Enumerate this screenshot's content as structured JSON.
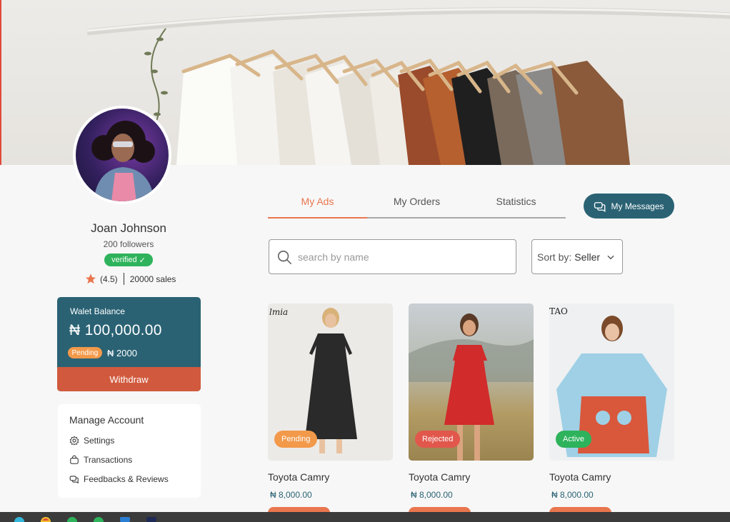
{
  "profile": {
    "name": "Joan Johnson",
    "followers": "200 followers",
    "verified": "verified",
    "rating": "(4.5)",
    "sales": "20000 sales"
  },
  "wallet": {
    "label": "Walet Balance",
    "amount": "₦ 100,000.00",
    "pending_label": "Pending",
    "pending_amount": "₦ 2000",
    "withdraw": "Withdraw"
  },
  "manage": {
    "title": "Manage Account",
    "items": [
      {
        "label": "Settings",
        "icon": "gear-icon"
      },
      {
        "label": "Transactions",
        "icon": "bag-icon"
      },
      {
        "label": "Feedbacks & Reviews",
        "icon": "chat-icon"
      }
    ]
  },
  "tabs": [
    {
      "label": "My Ads",
      "active": true
    },
    {
      "label": "My Orders",
      "active": false
    },
    {
      "label": "Statistics",
      "active": false
    }
  ],
  "messages_button": "My Messages",
  "search": {
    "placeholder": "search by name"
  },
  "sort": {
    "label": "Sort by:",
    "value": "Seller"
  },
  "products": [
    {
      "title": "Toyota Camry",
      "price": "₦ 8,000.00",
      "status": "Pending",
      "status_color": "#f2994a",
      "brand_text": "lmia"
    },
    {
      "title": "Toyota Camry",
      "price": "₦ 8,000.00",
      "status": "Rejected",
      "status_color": "#e2574c",
      "brand_text": ""
    },
    {
      "title": "Toyota Camry",
      "price": "₦ 8,000.00",
      "status": "Active",
      "status_color": "#2eb35c",
      "brand_text": "TAO"
    }
  ],
  "colors": {
    "primary": "#2a6274",
    "accent": "#e8764e",
    "danger": "#d15a3e",
    "success": "#2eb35c"
  }
}
